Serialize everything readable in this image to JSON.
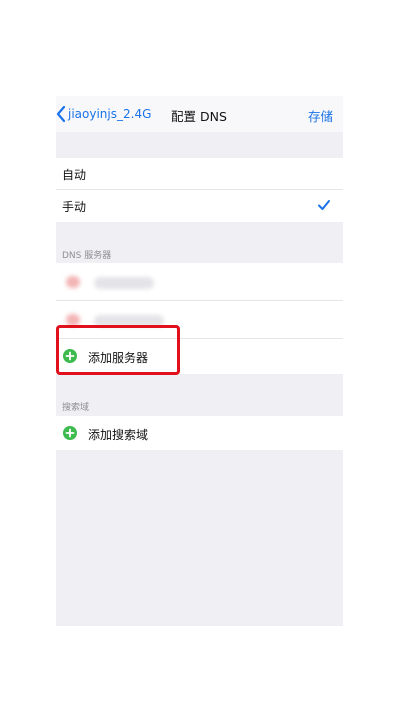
{
  "navbar": {
    "back_label": "jiaoyinjs_2.4G",
    "title": "配置 DNS",
    "save_label": "存储"
  },
  "mode": {
    "auto_label": "自动",
    "manual_label": "手动"
  },
  "dns_section": {
    "header": "DNS 服务器",
    "add_label": "添加服务器"
  },
  "search_section": {
    "header": "搜索域",
    "add_label": "添加搜索域"
  },
  "icons": {
    "back": "chevron-left-icon",
    "check": "checkmark-icon",
    "add": "plus-circle-icon"
  },
  "colors": {
    "accent": "#1a73e8",
    "add_green": "#3dbb4f",
    "highlight_red": "#e0101c"
  }
}
